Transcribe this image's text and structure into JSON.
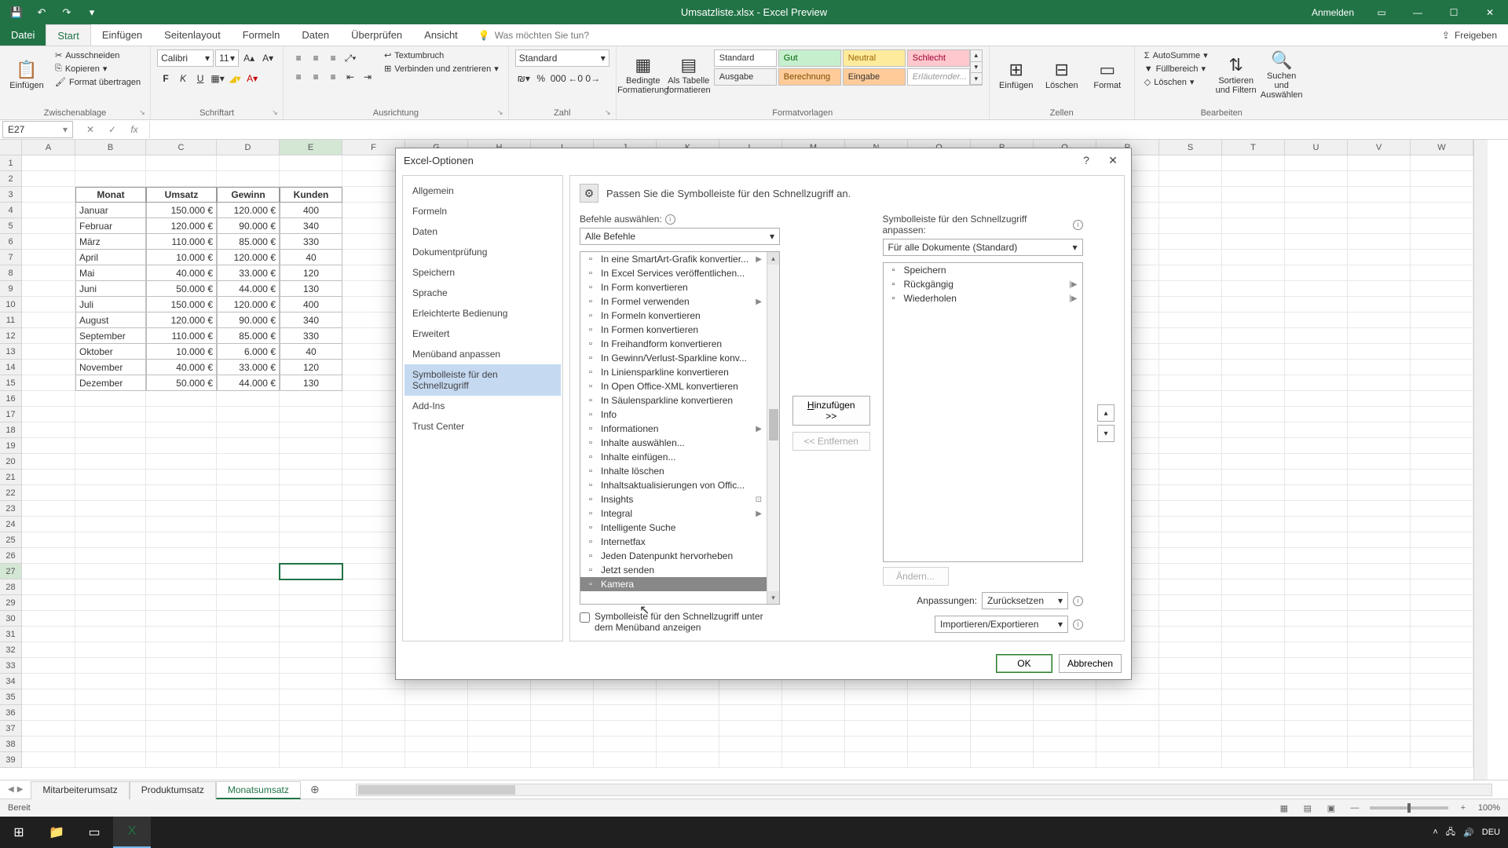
{
  "titlebar": {
    "title": "Umsatzliste.xlsx - Excel Preview",
    "signin": "Anmelden"
  },
  "qat": {
    "save": "💾",
    "undo": "↶",
    "redo": "↷",
    "custom": "▾"
  },
  "tabs": {
    "file": "Datei",
    "start": "Start",
    "einfuegen": "Einfügen",
    "seitenlayout": "Seitenlayout",
    "formeln": "Formeln",
    "daten": "Daten",
    "ueberpruefen": "Überprüfen",
    "ansicht": "Ansicht",
    "tell": "Was möchten Sie tun?",
    "share": "Freigeben"
  },
  "ribbon": {
    "einfuegen": "Einfügen",
    "clipboard": {
      "ausschneiden": "Ausschneiden",
      "kopieren": "Kopieren",
      "format": "Format übertragen",
      "group": "Zwischenablage"
    },
    "font": {
      "name": "Calibri",
      "size": "11",
      "group": "Schriftart"
    },
    "align": {
      "wrap": "Textumbruch",
      "merge": "Verbinden und zentrieren",
      "group": "Ausrichtung"
    },
    "number": {
      "format": "Standard",
      "group": "Zahl"
    },
    "styles": {
      "cond": "Bedingte Formatierung",
      "table": "Als Tabelle formatieren",
      "group": "Formatvorlagen",
      "standard": "Standard",
      "gut": "Gut",
      "neutral": "Neutral",
      "schlecht": "Schlecht",
      "ausgabe": "Ausgabe",
      "berechnung": "Berechnung",
      "eingabe": "Eingabe",
      "erl": "Erläuternder..."
    },
    "cells": {
      "einfuegen": "Einfügen",
      "loeschen": "Löschen",
      "format": "Format",
      "group": "Zellen"
    },
    "edit": {
      "sum": "AutoSumme",
      "fill": "Füllbereich",
      "clear": "Löschen",
      "sort": "Sortieren und Filtern",
      "find": "Suchen und Auswählen",
      "group": "Bearbeiten"
    }
  },
  "namebox": "E27",
  "columns": [
    "A",
    "B",
    "C",
    "D",
    "E",
    "F",
    "G",
    "H",
    "I",
    "J",
    "K",
    "L",
    "M",
    "N",
    "O",
    "P",
    "Q",
    "R",
    "S",
    "T",
    "U",
    "V",
    "W"
  ],
  "rows_count": 39,
  "active_cell": {
    "row": 27,
    "col": "E"
  },
  "table": {
    "headers": [
      "Monat",
      "Umsatz",
      "Gewinn",
      "Kunden"
    ],
    "data": [
      [
        "Januar",
        "150.000 €",
        "120.000 €",
        "400"
      ],
      [
        "Februar",
        "120.000 €",
        "90.000 €",
        "340"
      ],
      [
        "März",
        "110.000 €",
        "85.000 €",
        "330"
      ],
      [
        "April",
        "10.000 €",
        "120.000 €",
        "40"
      ],
      [
        "Mai",
        "40.000 €",
        "33.000 €",
        "120"
      ],
      [
        "Juni",
        "50.000 €",
        "44.000 €",
        "130"
      ],
      [
        "Juli",
        "150.000 €",
        "120.000 €",
        "400"
      ],
      [
        "August",
        "120.000 €",
        "90.000 €",
        "340"
      ],
      [
        "September",
        "110.000 €",
        "85.000 €",
        "330"
      ],
      [
        "Oktober",
        "10.000 €",
        "6.000 €",
        "40"
      ],
      [
        "November",
        "40.000 €",
        "33.000 €",
        "120"
      ],
      [
        "Dezember",
        "50.000 €",
        "44.000 €",
        "130"
      ]
    ]
  },
  "sheets": {
    "items": [
      "Mitarbeiterumsatz",
      "Produktumsatz",
      "Monatsumsatz"
    ],
    "active": 2
  },
  "status": {
    "ready": "Bereit",
    "zoom": "100%"
  },
  "dialog": {
    "title": "Excel-Optionen",
    "nav": [
      "Allgemein",
      "Formeln",
      "Daten",
      "Dokumentprüfung",
      "Speichern",
      "Sprache",
      "Erleichterte Bedienung",
      "Erweitert",
      "Menüband anpassen",
      "Symbolleiste für den Schnellzugriff",
      "Add-Ins",
      "Trust Center"
    ],
    "nav_active": 9,
    "heading": "Passen Sie die Symbolleiste für den Schnellzugriff an.",
    "left_label": "Befehle auswählen:",
    "left_combo": "Alle Befehle",
    "right_label": "Symbolleiste für den Schnellzugriff anpassen:",
    "right_combo": "Für alle Dokumente (Standard)",
    "commands": [
      {
        "name": "In eine SmartArt-Grafik konvertier...",
        "sub": "▶"
      },
      {
        "name": "In Excel Services veröffentlichen..."
      },
      {
        "name": "In Form konvertieren"
      },
      {
        "name": "In Formel verwenden",
        "sub": "▶"
      },
      {
        "name": "In Formeln konvertieren"
      },
      {
        "name": "In Formen konvertieren"
      },
      {
        "name": "In Freihandform konvertieren"
      },
      {
        "name": "In Gewinn/Verlust-Sparkline konv..."
      },
      {
        "name": "In Liniensparkline konvertieren"
      },
      {
        "name": "In Open Office-XML konvertieren"
      },
      {
        "name": "In Säulensparkline konvertieren"
      },
      {
        "name": "Info"
      },
      {
        "name": "Informationen",
        "sub": "▶"
      },
      {
        "name": "Inhalte auswählen..."
      },
      {
        "name": "Inhalte einfügen..."
      },
      {
        "name": "Inhalte löschen"
      },
      {
        "name": "Inhaltsaktualisierungen von Offic..."
      },
      {
        "name": "Insights",
        "sub": "⊡"
      },
      {
        "name": "Integral",
        "sub": "▶"
      },
      {
        "name": "Intelligente Suche"
      },
      {
        "name": "Internetfax"
      },
      {
        "name": "Jeden Datenpunkt hervorheben"
      },
      {
        "name": "Jetzt senden"
      },
      {
        "name": "Kamera"
      }
    ],
    "selected_idx": 23,
    "qat_items": [
      "Speichern",
      "Rückgängig",
      "Wiederholen"
    ],
    "add": "Hinzufügen >>",
    "remove": "<< Entfernen",
    "below_check": "Symbolleiste für den Schnellzugriff unter dem Menüband anzeigen",
    "modify": "Ändern...",
    "cust_label": "Anpassungen:",
    "reset": "Zurücksetzen",
    "import": "Importieren/Exportieren",
    "ok": "OK",
    "cancel": "Abbrechen"
  },
  "taskbar": {
    "time": "",
    "date": ""
  }
}
